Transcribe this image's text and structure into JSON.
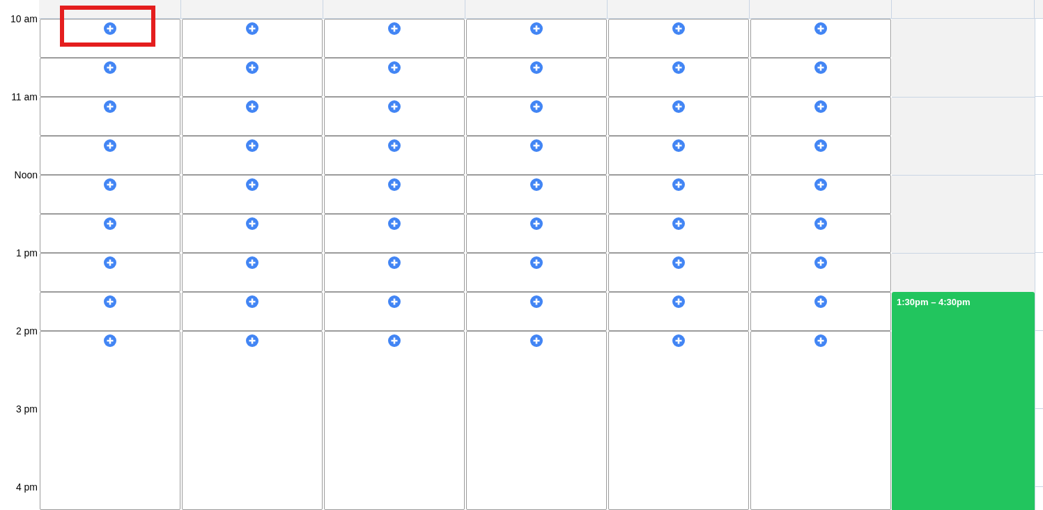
{
  "time_labels": [
    "10 am",
    "11 am",
    "Noon",
    "1 pm",
    "2 pm",
    "3 pm",
    "4 pm"
  ],
  "annotations": [
    {
      "kind": "highlight_frame"
    }
  ],
  "days": [
    {
      "cells": [
        {
          "kind": "slot"
        },
        {
          "kind": "slot"
        },
        {
          "kind": "slot"
        },
        {
          "kind": "slot"
        },
        {
          "kind": "slot"
        },
        {
          "kind": "slot"
        },
        {
          "kind": "slot"
        },
        {
          "kind": "slot"
        },
        {
          "kind": "slot"
        }
      ]
    },
    {
      "cells": [
        {
          "kind": "slot"
        },
        {
          "kind": "slot"
        },
        {
          "kind": "slot"
        },
        {
          "kind": "slot"
        },
        {
          "kind": "slot"
        },
        {
          "kind": "slot"
        },
        {
          "kind": "slot"
        },
        {
          "kind": "slot"
        },
        {
          "kind": "slot"
        }
      ]
    },
    {
      "cells": [
        {
          "kind": "slot"
        },
        {
          "kind": "slot"
        },
        {
          "kind": "slot"
        },
        {
          "kind": "slot"
        },
        {
          "kind": "slot"
        },
        {
          "kind": "slot"
        },
        {
          "kind": "slot"
        },
        {
          "kind": "slot"
        },
        {
          "kind": "slot"
        }
      ]
    },
    {
      "cells": [
        {
          "kind": "slot"
        },
        {
          "kind": "slot"
        },
        {
          "kind": "slot"
        },
        {
          "kind": "slot"
        },
        {
          "kind": "slot"
        },
        {
          "kind": "slot"
        },
        {
          "kind": "slot"
        },
        {
          "kind": "slot"
        },
        {
          "kind": "slot"
        }
      ]
    },
    {
      "cells": [
        {
          "kind": "slot"
        },
        {
          "kind": "slot"
        },
        {
          "kind": "slot"
        },
        {
          "kind": "slot"
        },
        {
          "kind": "slot"
        },
        {
          "kind": "slot"
        },
        {
          "kind": "slot"
        },
        {
          "kind": "slot"
        },
        {
          "kind": "slot"
        }
      ]
    },
    {
      "cells": [
        {
          "kind": "slot"
        },
        {
          "kind": "slot"
        },
        {
          "kind": "slot"
        },
        {
          "kind": "slot"
        },
        {
          "kind": "slot"
        },
        {
          "kind": "slot"
        },
        {
          "kind": "slot"
        },
        {
          "kind": "slot"
        },
        {
          "kind": "slot"
        }
      ]
    },
    {
      "cells": [
        {
          "kind": "blank"
        },
        {
          "kind": "blank"
        },
        {
          "kind": "blank"
        },
        {
          "kind": "blank"
        },
        {
          "kind": "blank"
        },
        {
          "kind": "blank"
        },
        {
          "kind": "blank"
        },
        {
          "kind": "event",
          "label": "1:30pm – 4:30pm",
          "color": "#22c55e"
        }
      ]
    }
  ]
}
